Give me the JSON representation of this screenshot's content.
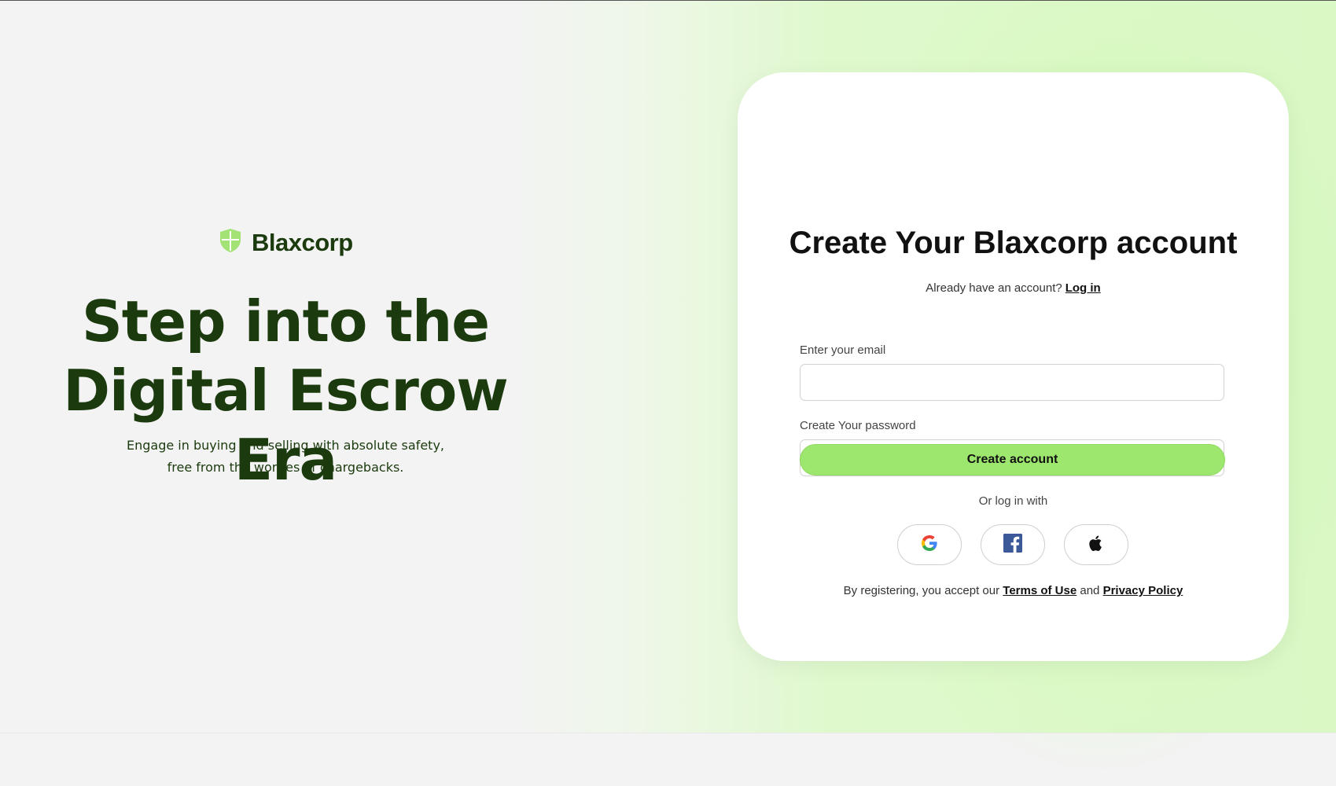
{
  "brand": {
    "name": "Blaxcorp",
    "icon": "shield-icon",
    "color": "#1b3a0e",
    "icon_color": "#a3e274"
  },
  "hero": {
    "line1": "Step into the",
    "line2": "Digital Escrow Era",
    "tagline_line1": "Engage in buying and selling with absolute safety,",
    "tagline_line2": "free from the worries of chargebacks."
  },
  "form": {
    "title": "Create Your Blaxcorp account",
    "login_prompt": "Already have an account?",
    "login_link": "Log in",
    "email_label": "Enter your email",
    "email_value": "",
    "password_label": "Create Your password",
    "password_value": "",
    "password_toggle_icon": "eye-closed-icon",
    "submit_label": "Create account",
    "submit_color": "#9ee76e",
    "or_text": "Or log in with",
    "social": [
      {
        "name": "Google",
        "icon": "google-icon"
      },
      {
        "name": "Facebook",
        "icon": "facebook-icon"
      },
      {
        "name": "Apple",
        "icon": "apple-icon"
      }
    ],
    "terms_prefix": "By registering, you accept our",
    "terms_link": "Terms of Use",
    "terms_and": "and",
    "privacy_link": "Privacy Policy"
  }
}
